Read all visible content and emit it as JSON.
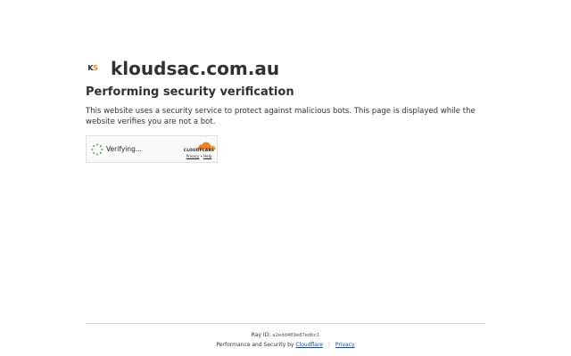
{
  "site": {
    "favicon_k": "K",
    "favicon_s": "S",
    "name": "kloudsac.com.au"
  },
  "main": {
    "heading": "Performing security verification",
    "description": "This website uses a security service to protect against malicious bots. This page is displayed while the website verifies you are not a bot."
  },
  "widget": {
    "status": "Verifying...",
    "brand": "CLOUDFLARE",
    "privacy_link": "Privacy",
    "link_separator": "•",
    "help_link": "Help",
    "spinner_color": "#2a8a3e",
    "brand_orange": "#f38020"
  },
  "footer": {
    "ray_label": "Ray ID:",
    "ray_id": "a2edd409e87edbc1",
    "performance_text": "Performance and Security by",
    "cloudflare_link": "Cloudflare",
    "separator": "|",
    "privacy_link": "Privacy",
    "link_color": "#0051c3"
  }
}
